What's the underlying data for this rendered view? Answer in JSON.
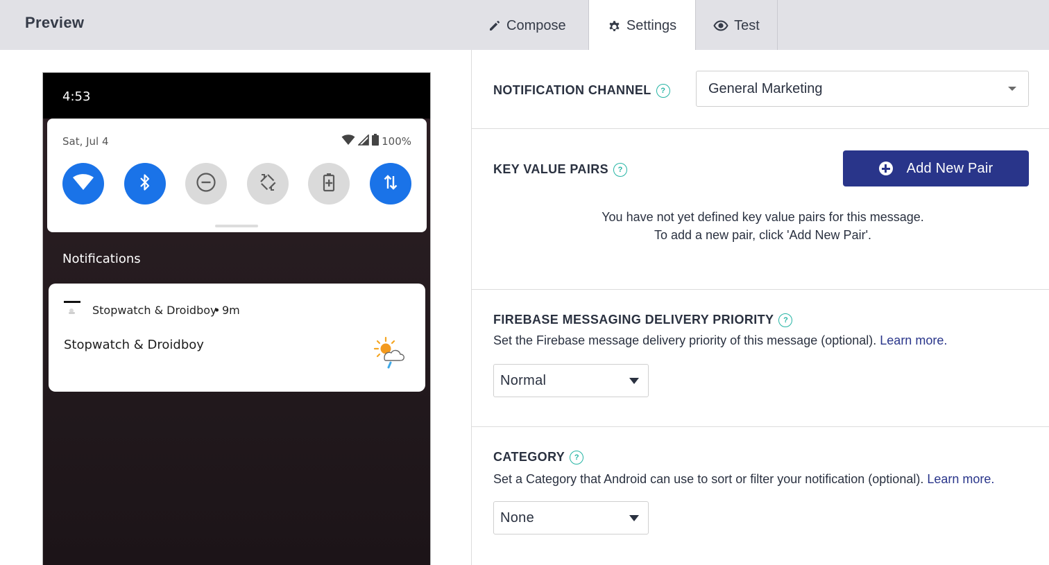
{
  "header": {
    "preview_title": "Preview",
    "tabs": [
      {
        "label": "Compose",
        "icon": "pencil-icon",
        "active": false
      },
      {
        "label": "Settings",
        "icon": "gear-icon",
        "active": true
      },
      {
        "label": "Test",
        "icon": "eye-icon",
        "active": false
      }
    ]
  },
  "phone": {
    "clock": "4:53",
    "date": "Sat, Jul 4",
    "battery": "100%",
    "tiles": [
      {
        "icon": "wifi-icon",
        "on": true
      },
      {
        "icon": "bluetooth-icon",
        "on": true
      },
      {
        "icon": "do-not-disturb-icon",
        "on": false
      },
      {
        "icon": "auto-rotate-icon",
        "on": false
      },
      {
        "icon": "battery-saver-icon",
        "on": false
      },
      {
        "icon": "mobile-data-icon",
        "on": true
      }
    ],
    "notifications_header": "Notifications",
    "notification": {
      "app_name": "Stopwatch & Droidboy",
      "bullet": "•",
      "time": "9m",
      "title": "Stopwatch & Droidboy"
    },
    "colors": {
      "tile_on": "#1a73e8",
      "tile_off": "#dadada"
    }
  },
  "settings": {
    "channel": {
      "label": "NOTIFICATION CHANNEL",
      "help": "?",
      "value": "General Marketing"
    },
    "key_value": {
      "label": "KEY VALUE PAIRS",
      "help": "?",
      "add_button": "Add New Pair",
      "empty_line1": "You have not yet defined key value pairs for this message.",
      "empty_line2": "To add a new pair, click 'Add New Pair'."
    },
    "priority": {
      "label": "FIREBASE MESSAGING DELIVERY PRIORITY",
      "help": "?",
      "description": "Set the Firebase message delivery priority of this message (optional).",
      "learn_more": "Learn more.",
      "value": "Normal"
    },
    "category": {
      "label": "CATEGORY",
      "help": "?",
      "description": "Set a Category that Android can use to sort or filter your notification (optional).",
      "learn_more": "Learn more.",
      "value": "None"
    },
    "colors": {
      "primary_button": "#29358a",
      "help_accent": "#25b4a4",
      "link": "#29358a"
    }
  }
}
